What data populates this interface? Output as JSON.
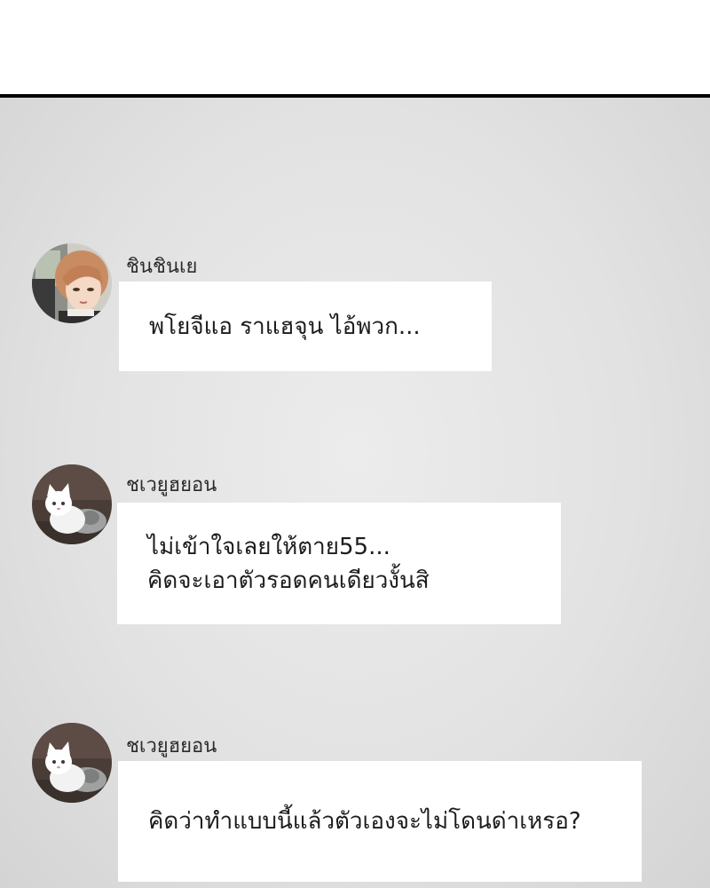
{
  "colors": {
    "bubble_background": "#ffffff",
    "chat_background": "#e3e3e3",
    "divider": "#000000",
    "text": "#1c1c1c"
  },
  "messages": [
    {
      "sender": "ชินชินเย",
      "avatar_icon": "girl-portrait-avatar",
      "lines": [
        "พโยจีแอ ราแฮจุน ไอ้พวก..."
      ]
    },
    {
      "sender": "ชเวยูฮยอน",
      "avatar_icon": "white-cat-avatar",
      "lines": [
        "ไม่เข้าใจเลยให้ตาย55...",
        "คิดจะเอาตัวรอดคนเดียวงั้นสิ"
      ]
    },
    {
      "sender": "ชเวยูฮยอน",
      "avatar_icon": "white-cat-avatar",
      "lines": [
        "คิดว่าทำแบบนี้แล้วตัวเองจะไม่โดนด่าเหรอ?"
      ]
    }
  ]
}
